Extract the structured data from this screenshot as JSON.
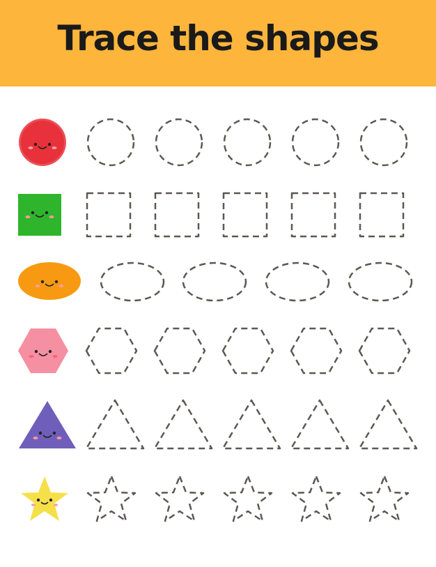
{
  "header": {
    "title": "Trace the shapes",
    "background": "#fdb53c"
  },
  "rows": [
    {
      "shape": "circle",
      "color": "#e8313a",
      "trace_count": 5
    },
    {
      "shape": "square",
      "color": "#2fb52c",
      "trace_count": 5
    },
    {
      "shape": "oval",
      "color": "#f79a12",
      "trace_count": 4
    },
    {
      "shape": "hexagon",
      "color": "#f58fa2",
      "trace_count": 5
    },
    {
      "shape": "triangle",
      "color": "#6f5fba",
      "trace_count": 5
    },
    {
      "shape": "star",
      "color": "#f5e04a",
      "trace_count": 5
    }
  ],
  "trace_color": "#5d5753"
}
